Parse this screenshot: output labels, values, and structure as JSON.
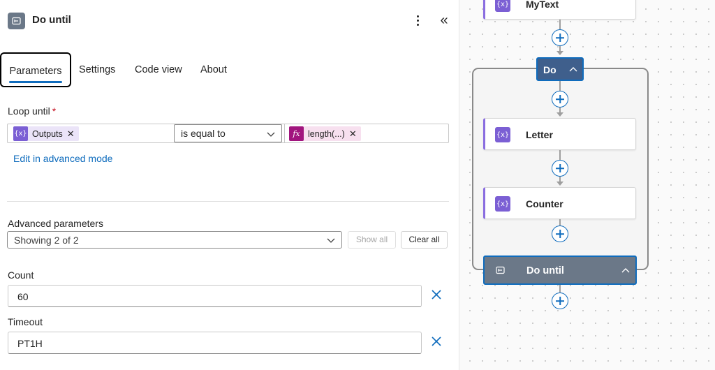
{
  "panel": {
    "title": "Do until",
    "more_icon": "more-vertical-icon",
    "collapse_icon": "double-chevron-left-icon"
  },
  "tabs": [
    {
      "label": "Parameters",
      "active": true
    },
    {
      "label": "Settings"
    },
    {
      "label": "Code view"
    },
    {
      "label": "About"
    }
  ],
  "loop_until": {
    "label": "Loop until",
    "required_mark": "*",
    "left_token": {
      "label": "Outputs",
      "icon": "variable-icon"
    },
    "operator": "is equal to",
    "right_token": {
      "label": "length(...)",
      "icon": "fx-icon"
    },
    "token_remove": "✕",
    "advanced_link": "Edit in advanced mode"
  },
  "advanced": {
    "label": "Advanced parameters",
    "selected": "Showing 2 of 2",
    "show_all": "Show all",
    "clear_all": "Clear all"
  },
  "count": {
    "label": "Count",
    "value": "60"
  },
  "timeout": {
    "label": "Timeout",
    "value": "PT1H"
  },
  "canvas": {
    "top_card": "MyText",
    "do_label": "Do",
    "cards": [
      "Letter",
      "Counter"
    ],
    "until_label": "Do until",
    "card_icon_glyph": "{x}"
  },
  "colors": {
    "accent": "#0f6cbd",
    "variable_purple": "#7b5fd4",
    "fx_magenta": "#a1157e",
    "loop_header": "#6b7888",
    "do_chip": "#3f5f8c",
    "required_red": "#c50f1f"
  }
}
